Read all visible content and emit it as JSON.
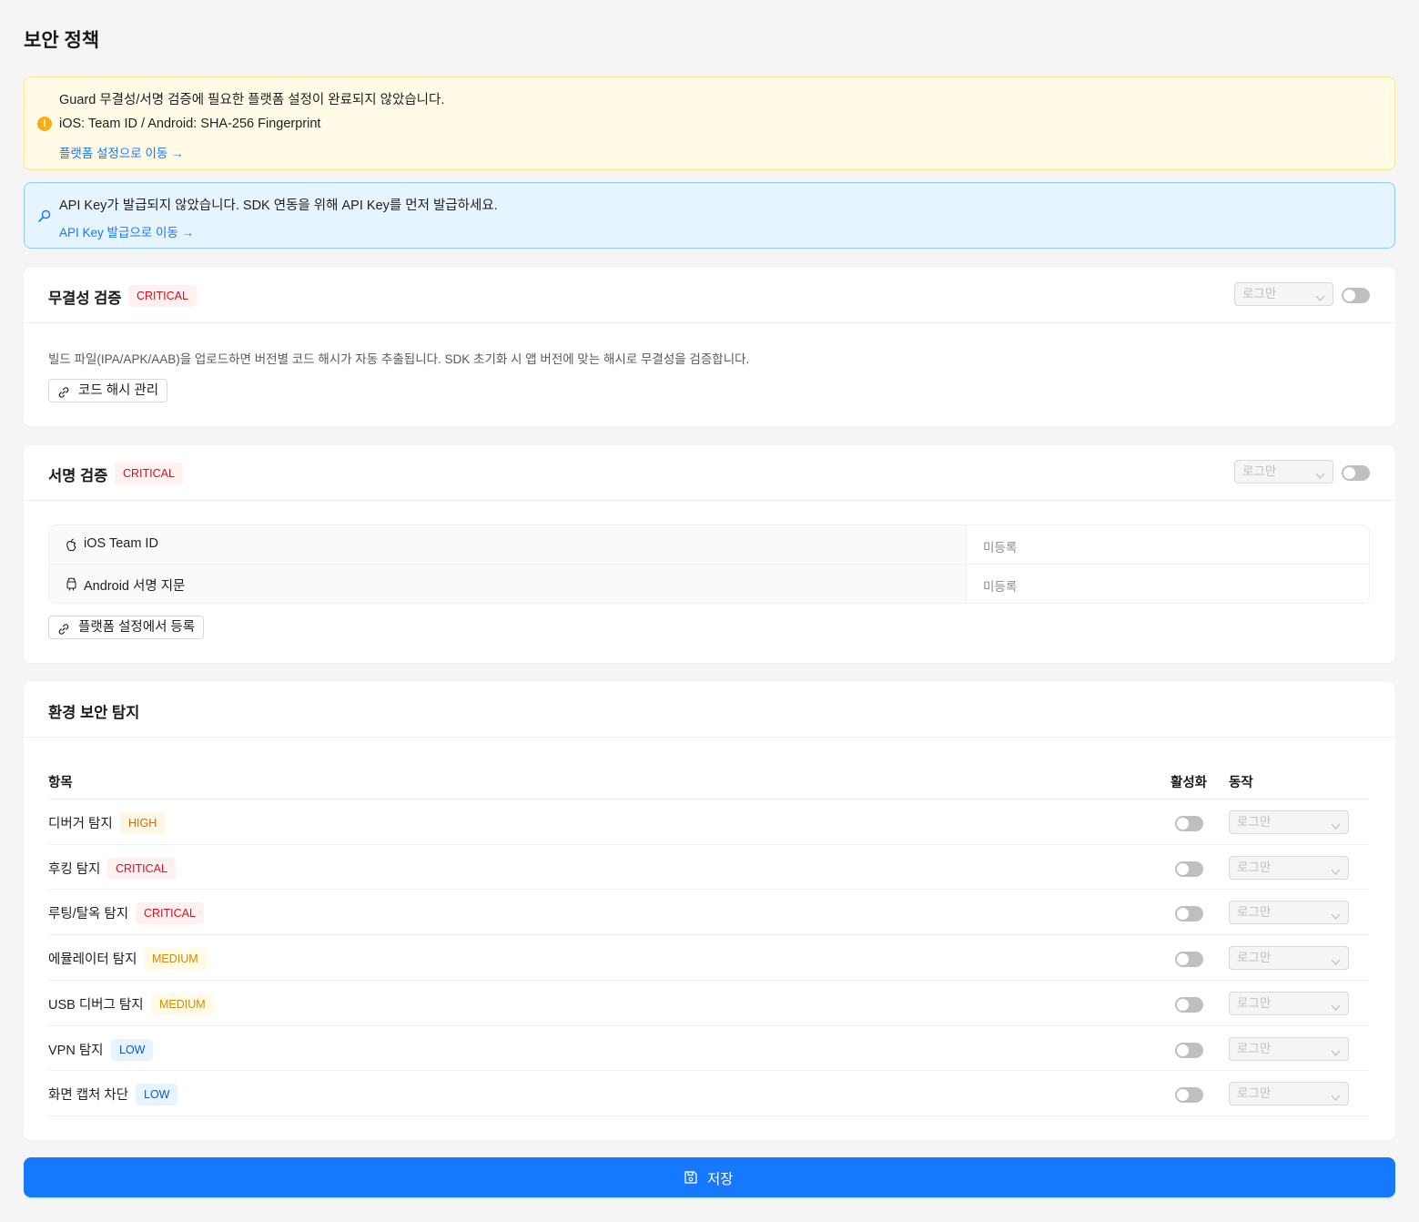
{
  "page": {
    "title": "보안 정책"
  },
  "alerts": {
    "platform": {
      "line1": "Guard 무결성/서명 검증에 필요한 플랫폼 설정이 완료되지 않았습니다.",
      "line2": "iOS: Team ID / Android: SHA-256 Fingerprint",
      "link": "플랫폼 설정으로 이동 →",
      "icon": "warning-icon"
    },
    "apikey": {
      "line1": "API Key가 발급되지 않았습니다. SDK 연동을 위해 API Key를 먼저 발급하세요.",
      "link": "API Key 발급으로 이동 →",
      "icon": "key-icon"
    }
  },
  "integrity": {
    "title": "무결성 검증",
    "severity": "CRITICAL",
    "action": "로그만",
    "enabled": false,
    "description": "빌드 파일(IPA/APK/AAB)을 업로드하면 버전별 코드 해시가 자동 추출됩니다. SDK 초기화 시 앱 버전에 맞는 해시로 무결성을 검증합니다.",
    "button": "코드 해시 관리"
  },
  "signature": {
    "title": "서명 검증",
    "severity": "CRITICAL",
    "action": "로그만",
    "enabled": false,
    "rows": [
      {
        "label": "iOS Team ID",
        "value": "미등록",
        "icon": "apple-icon"
      },
      {
        "label": "Android 서명 지문",
        "value": "미등록",
        "icon": "android-icon"
      }
    ],
    "button": "플랫폼 설정에서 등록"
  },
  "environment": {
    "title": "환경 보안 탐지",
    "columns": {
      "item": "항목",
      "enabled": "활성화",
      "action": "동작"
    },
    "rows": [
      {
        "name": "디버거 탐지",
        "severity": "HIGH",
        "enabled": false,
        "action": "로그만"
      },
      {
        "name": "후킹 탐지",
        "severity": "CRITICAL",
        "enabled": false,
        "action": "로그만"
      },
      {
        "name": "루팅/탈옥 탐지",
        "severity": "CRITICAL",
        "enabled": false,
        "action": "로그만"
      },
      {
        "name": "에뮬레이터 탐지",
        "severity": "MEDIUM",
        "enabled": false,
        "action": "로그만"
      },
      {
        "name": "USB 디버그 탐지",
        "severity": "MEDIUM",
        "enabled": false,
        "action": "로그만"
      },
      {
        "name": "VPN 탐지",
        "severity": "LOW",
        "enabled": false,
        "action": "로그만"
      },
      {
        "name": "화면 캡처 차단",
        "severity": "LOW",
        "enabled": false,
        "action": "로그만"
      }
    ]
  },
  "save": {
    "label": "저장",
    "icon": "save-icon"
  },
  "colors": {
    "primary": "#1677ff",
    "critical": "#cf1322",
    "high": "#d46b08",
    "medium": "#d48806",
    "low": "#0958d9",
    "warning_bg": "#fffbe6",
    "info_bg": "#e6f4ff"
  }
}
